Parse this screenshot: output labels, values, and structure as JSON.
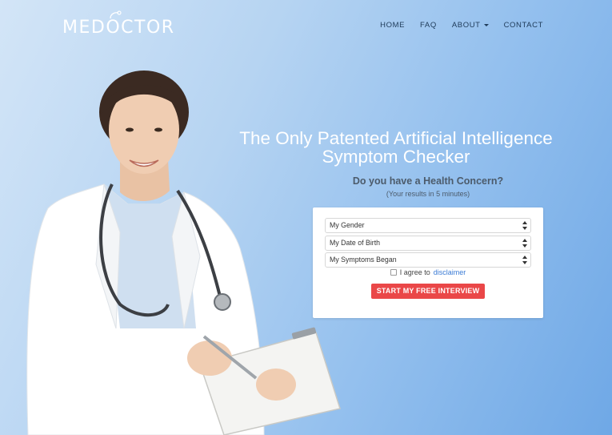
{
  "brand": {
    "logo_text_before": "MED",
    "logo_text_o": "O",
    "logo_text_after": "CTOR"
  },
  "nav": {
    "items": [
      {
        "label": "HOME"
      },
      {
        "label": "FAQ"
      },
      {
        "label": "ABOUT",
        "has_dropdown": true
      },
      {
        "label": "CONTACT"
      }
    ]
  },
  "hero": {
    "title_line1": "The Only Patented Artificial Intelligence",
    "title_line2": "Symptom Checker",
    "subtitle": "Do you have a Health Concern?",
    "note": "(Your results in 5 minutes)"
  },
  "form": {
    "gender": {
      "selected": "My Gender"
    },
    "dob": {
      "selected": "My Date of Birth"
    },
    "symptoms": {
      "selected": "My Symptoms Began"
    },
    "agree_text": "I agree to",
    "disclaimer_link": "disclaimer",
    "cta_label": "START MY FREE INTERVIEW"
  },
  "colors": {
    "cta": "#ea4748",
    "link": "#3a7bd5",
    "nav_text": "#1e3a58",
    "background_light": "#d3e5f7",
    "background_dark": "#6fa8e6"
  }
}
